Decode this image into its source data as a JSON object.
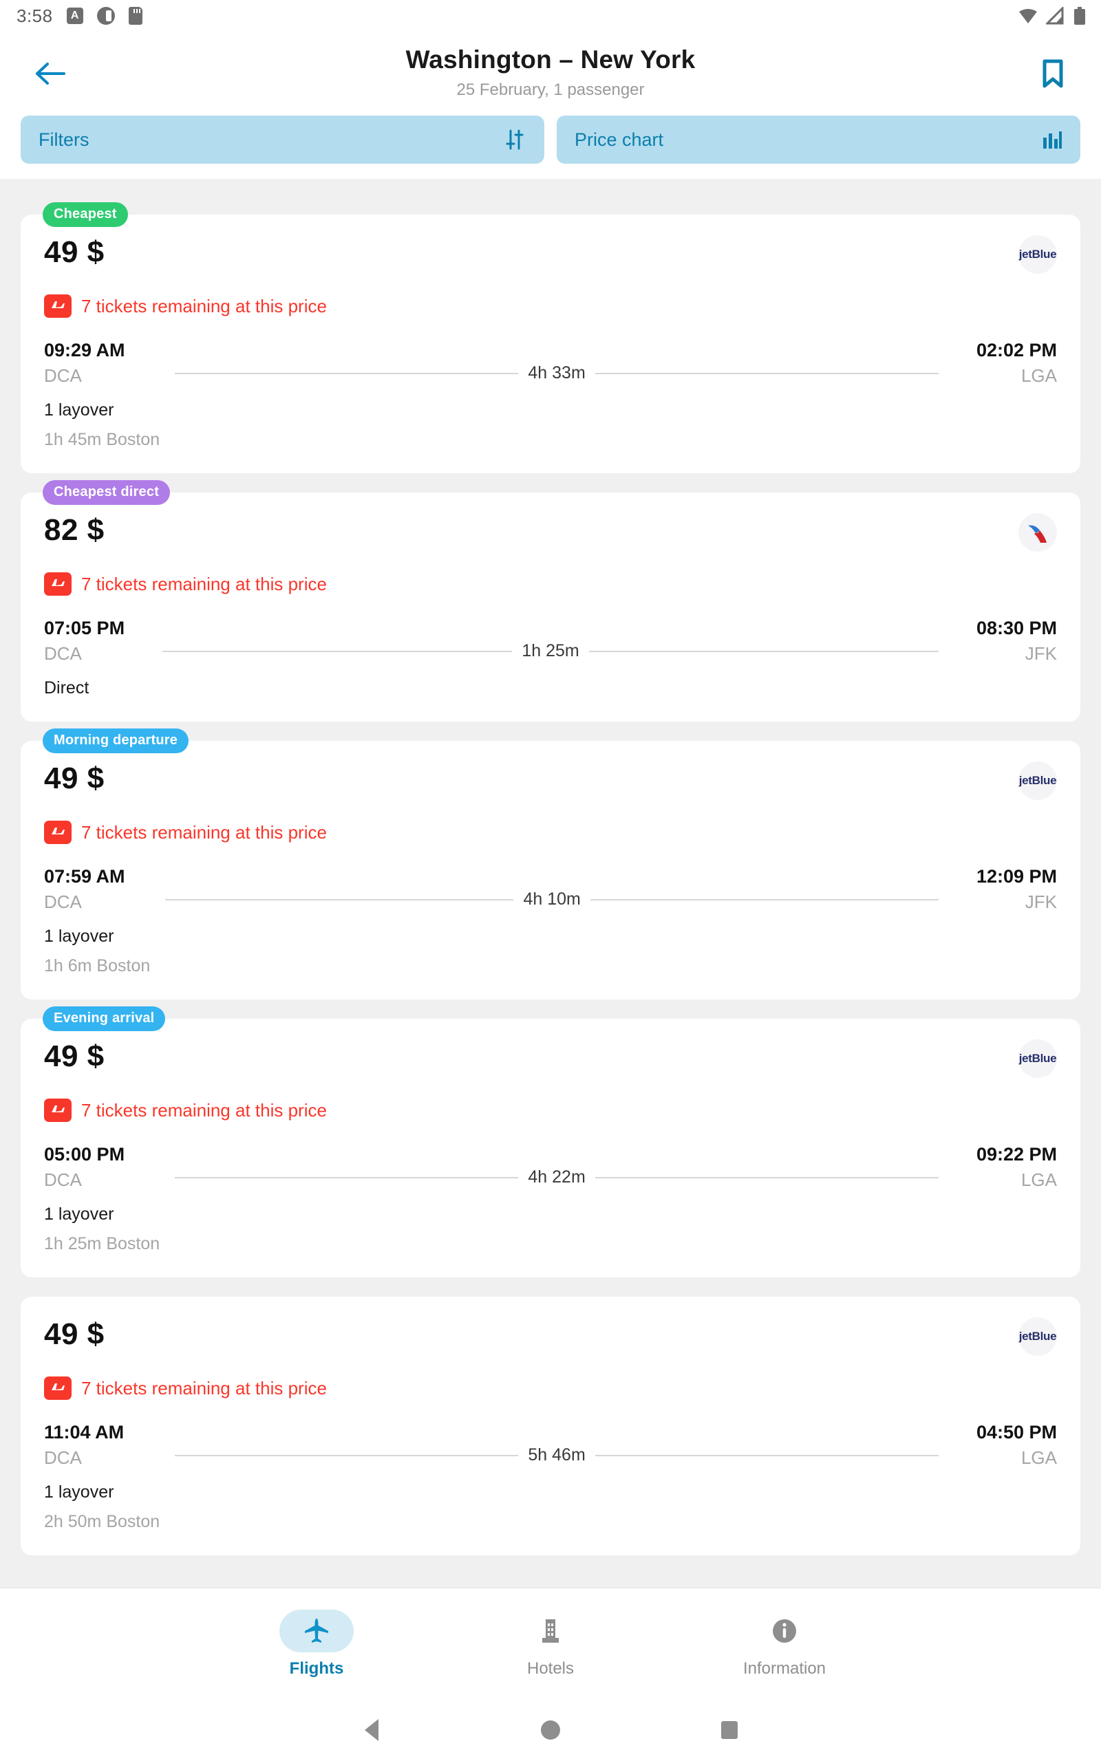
{
  "status_bar": {
    "time": "3:58",
    "icons_left": [
      "a-badge-icon",
      "do-not-disturb-icon",
      "sd-card-icon"
    ],
    "icons_right": [
      "wifi-icon",
      "signal-icon",
      "battery-icon"
    ]
  },
  "header": {
    "back_icon": "back-arrow-icon",
    "title": "Washington – New York",
    "subtitle": "25 February, 1 passenger",
    "bookmark_icon": "bookmark-icon"
  },
  "filter_bar": {
    "filters_label": "Filters",
    "filters_icon": "sliders-icon",
    "price_chart_label": "Price chart",
    "price_chart_icon": "bar-chart-icon",
    "accent_bg": "#b4dcef",
    "accent_fg": "#0b7fad"
  },
  "alert_text": "7 tickets remaining at this price",
  "alert_color": "#f8372b",
  "badge_colors": {
    "green": "#2ecb71",
    "purple": "#b07ce8",
    "blue": "#34b3f1"
  },
  "flights": [
    {
      "badge": "Cheapest",
      "badge_style": "green",
      "price": "49 $",
      "airline": "jetBlue",
      "airline_logo": "jetblue-logo",
      "alert": "7 tickets remaining at this price",
      "depart_time": "09:29 AM",
      "depart_code": "DCA",
      "duration": "4h 33m",
      "arrive_time": "02:02 PM",
      "arrive_code": "LGA",
      "stops": "1 layover",
      "layover": "1h 45m Boston"
    },
    {
      "badge": "Cheapest direct",
      "badge_style": "purple",
      "price": "82 $",
      "airline": "American Airlines",
      "airline_logo": "american-airlines-logo",
      "alert": "7 tickets remaining at this price",
      "depart_time": "07:05 PM",
      "depart_code": "DCA",
      "duration": "1h 25m",
      "arrive_time": "08:30 PM",
      "arrive_code": "JFK",
      "stops": "Direct",
      "layover": ""
    },
    {
      "badge": "Morning departure",
      "badge_style": "blue",
      "price": "49 $",
      "airline": "jetBlue",
      "airline_logo": "jetblue-logo",
      "alert": "7 tickets remaining at this price",
      "depart_time": "07:59 AM",
      "depart_code": "DCA",
      "duration": "4h 10m",
      "arrive_time": "12:09 PM",
      "arrive_code": "JFK",
      "stops": "1 layover",
      "layover": "1h 6m Boston"
    },
    {
      "badge": "Evening arrival",
      "badge_style": "blue",
      "price": "49 $",
      "airline": "jetBlue",
      "airline_logo": "jetblue-logo",
      "alert": "7 tickets remaining at this price",
      "depart_time": "05:00 PM",
      "depart_code": "DCA",
      "duration": "4h 22m",
      "arrive_time": "09:22 PM",
      "arrive_code": "LGA",
      "stops": "1 layover",
      "layover": "1h 25m Boston"
    },
    {
      "badge": "",
      "badge_style": "",
      "price": "49 $",
      "airline": "jetBlue",
      "airline_logo": "jetblue-logo",
      "alert": "7 tickets remaining at this price",
      "depart_time": "11:04 AM",
      "depart_code": "DCA",
      "duration": "5h 46m",
      "arrive_time": "04:50 PM",
      "arrive_code": "LGA",
      "stops": "1 layover",
      "layover": "2h 50m Boston"
    }
  ],
  "bottom_nav": {
    "items": [
      {
        "label": "Flights",
        "icon": "airplane-icon",
        "active": true
      },
      {
        "label": "Hotels",
        "icon": "building-icon",
        "active": false
      },
      {
        "label": "Information",
        "icon": "info-icon",
        "active": false
      }
    ]
  },
  "system_nav": {
    "back": "system-back-icon",
    "home": "system-home-icon",
    "recents": "system-recents-icon"
  }
}
